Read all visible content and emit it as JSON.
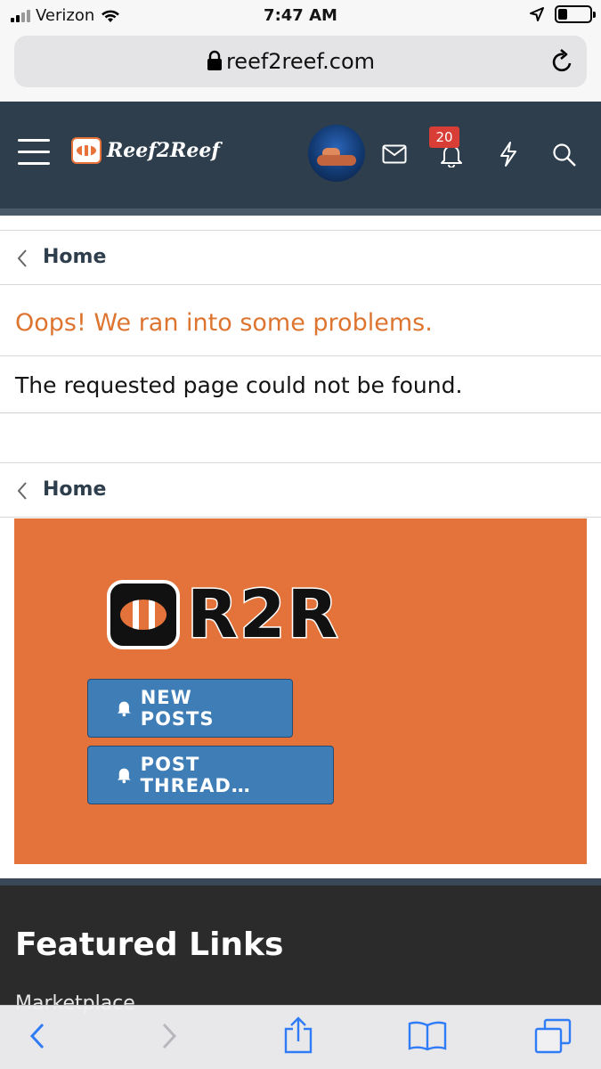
{
  "status_bar": {
    "carrier": "Verizon",
    "time": "7:47 AM",
    "icons": [
      "signal-icon",
      "wifi-icon",
      "location-icon",
      "battery-icon"
    ]
  },
  "browser": {
    "url": "reef2reef.com",
    "icons": [
      "lock-icon",
      "reload-icon"
    ]
  },
  "site_header": {
    "logo_text": "Reef2Reef",
    "notification_count": "20",
    "icons": [
      "menu-icon",
      "envelope-icon",
      "bell-icon",
      "lightning-icon",
      "search-icon"
    ],
    "brand_color": "#2e3e4c"
  },
  "breadcrumb_top": {
    "label": "Home"
  },
  "error": {
    "title": "Oops! We ran into some problems.",
    "message": "The requested page could not be found.",
    "title_color": "#dd7530"
  },
  "breadcrumb_bottom": {
    "label": "Home"
  },
  "banner": {
    "logo_text": "R2R",
    "new_posts_label": "NEW POSTS",
    "post_thread_label": "POST THREAD…",
    "background_color": "#e3733a",
    "button_color": "#3f7db7"
  },
  "footer": {
    "heading": "Featured Links",
    "first_link": "Marketplace"
  },
  "toolbar": {
    "icons": [
      "back-icon",
      "forward-icon",
      "share-icon",
      "bookmarks-icon",
      "tabs-icon"
    ]
  }
}
